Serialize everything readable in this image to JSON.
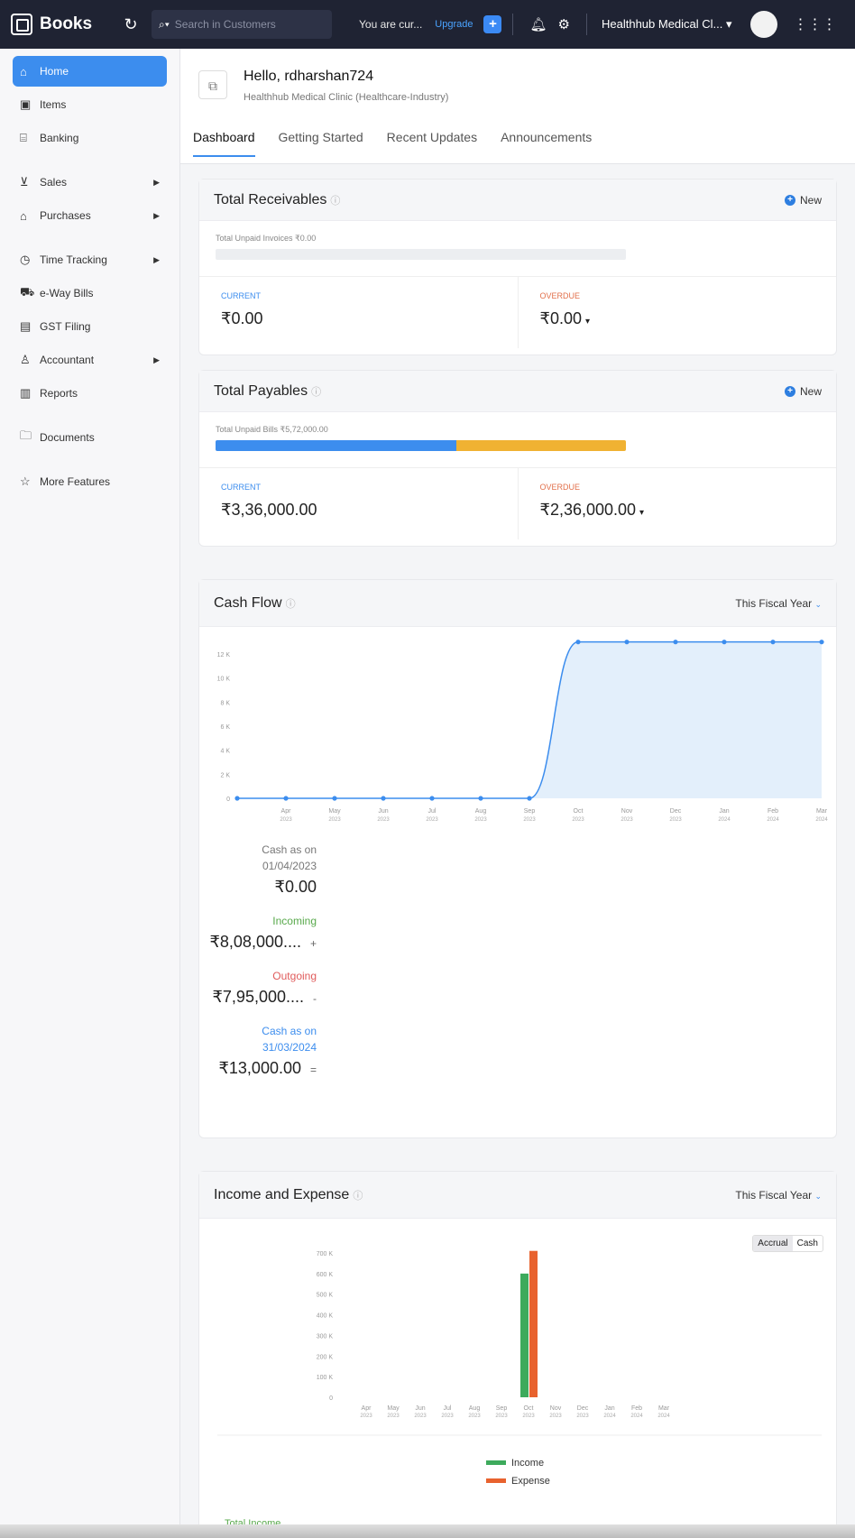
{
  "topbar": {
    "app_name": "Books",
    "search_scope_icon": "search-icon",
    "search_placeholder": "Search in Customers",
    "trial_text": "You are cur...",
    "upgrade_label": "Upgrade",
    "org_switcher": "Healthhub Medical Cl... ▾"
  },
  "sidebar": {
    "items": [
      {
        "label": "Home",
        "icon": "home-icon",
        "active": true
      },
      {
        "label": "Items",
        "icon": "box-icon"
      },
      {
        "label": "Banking",
        "icon": "bank-icon"
      },
      {
        "label": "Sales",
        "icon": "cart-icon",
        "arrow": true
      },
      {
        "label": "Purchases",
        "icon": "bag-icon",
        "arrow": true
      },
      {
        "label": "Time Tracking",
        "icon": "clock-icon",
        "arrow": true
      },
      {
        "label": "e-Way Bills",
        "icon": "truck-icon"
      },
      {
        "label": "GST Filing",
        "icon": "file-icon"
      },
      {
        "label": "Accountant",
        "icon": "user-icon",
        "arrow": true
      },
      {
        "label": "Reports",
        "icon": "chart-icon"
      },
      {
        "label": "Documents",
        "icon": "folder-icon"
      },
      {
        "label": "More Features",
        "icon": "star-icon"
      }
    ]
  },
  "header": {
    "greeting": "Hello, rdharshan724",
    "org_line": "Healthhub Medical Clinic (Healthcare-Industry)",
    "tabs": [
      "Dashboard",
      "Getting Started",
      "Recent Updates",
      "Announcements"
    ]
  },
  "receivables": {
    "title": "Total Receivables",
    "new_label": "New",
    "unpaid_text": "Total Unpaid Invoices ₹0.00",
    "current_label": "CURRENT",
    "current_value": "₹0.00",
    "overdue_label": "OVERDUE",
    "overdue_value": "₹0.00",
    "current_fraction": 0,
    "overdue_fraction": 0,
    "current_color": "#3c8dee",
    "overdue_color": "#f0b232"
  },
  "payables": {
    "title": "Total Payables",
    "new_label": "New",
    "unpaid_text": "Total Unpaid Bills ₹5,72,000.00",
    "current_label": "CURRENT",
    "current_value": "₹3,36,000.00",
    "overdue_label": "OVERDUE",
    "overdue_value": "₹2,36,000.00",
    "current_fraction": 0.587,
    "overdue_fraction": 0.413,
    "current_color": "#3c8dee",
    "overdue_color": "#f0b232"
  },
  "cashflow": {
    "title": "Cash Flow",
    "period": "This Fiscal Year",
    "start_label": "Cash as on",
    "start_date": "01/04/2023",
    "start_value": "₹0.00",
    "incoming_label": "Incoming",
    "incoming_value": "₹8,08,000....",
    "incoming_sign": "+",
    "outgoing_label": "Outgoing",
    "outgoing_value": "₹7,95,000....",
    "outgoing_sign": "-",
    "end_label": "Cash as on",
    "end_date": "31/03/2024",
    "end_value": "₹13,000.00",
    "end_sign": "="
  },
  "income_expense": {
    "title": "Income and Expense",
    "period": "This Fiscal Year",
    "toggle_accrual": "Accrual",
    "toggle_cash": "Cash",
    "total_income_label": "Total Income"
  },
  "chart_data": [
    {
      "type": "area",
      "x": [
        "Apr 2023",
        "May 2023",
        "Jun 2023",
        "Jul 2023",
        "Aug 2023",
        "Sep 2023",
        "Oct 2023",
        "Nov 2023",
        "Dec 2023",
        "Jan 2024",
        "Feb 2024",
        "Mar 2024"
      ],
      "x_top": [
        "",
        "Apr",
        "May",
        "Jun",
        "Jul",
        "Aug",
        "Sep",
        "Oct",
        "Nov",
        "Dec",
        "Jan",
        "Feb",
        "Mar"
      ],
      "x_bottom": [
        "",
        "2023",
        "2023",
        "2023",
        "2023",
        "2023",
        "2023",
        "2023",
        "2023",
        "2023",
        "2024",
        "2024",
        "2024"
      ],
      "values": [
        0,
        0,
        0,
        0,
        0,
        0,
        0,
        13000,
        13000,
        13000,
        13000,
        13000,
        13000
      ],
      "yticks": [
        "0",
        "2 K",
        "4 K",
        "6 K",
        "8 K",
        "10 K",
        "12 K"
      ],
      "ylim": [
        0,
        12000
      ],
      "color": "#3c8dee",
      "fill": "#e3effb"
    },
    {
      "type": "bar",
      "categories": [
        "Apr",
        "May",
        "Jun",
        "Jul",
        "Aug",
        "Sep",
        "Oct",
        "Nov",
        "Dec",
        "Jan",
        "Feb",
        "Mar"
      ],
      "years": [
        "2023",
        "2023",
        "2023",
        "2023",
        "2023",
        "2023",
        "2023",
        "2023",
        "2023",
        "2024",
        "2024",
        "2024"
      ],
      "series": [
        {
          "name": "Income",
          "color": "#3daa5c",
          "values": [
            0,
            0,
            0,
            0,
            0,
            0,
            600000,
            0,
            0,
            0,
            0,
            0
          ]
        },
        {
          "name": "Expense",
          "color": "#e8622e",
          "values": [
            0,
            0,
            0,
            0,
            0,
            0,
            710000,
            0,
            0,
            0,
            0,
            0
          ]
        }
      ],
      "yticks": [
        "0",
        "100 K",
        "200 K",
        "300 K",
        "400 K",
        "500 K",
        "600 K",
        "700 K"
      ],
      "ylim": [
        0,
        700000
      ],
      "legend": "bottom-center"
    }
  ]
}
